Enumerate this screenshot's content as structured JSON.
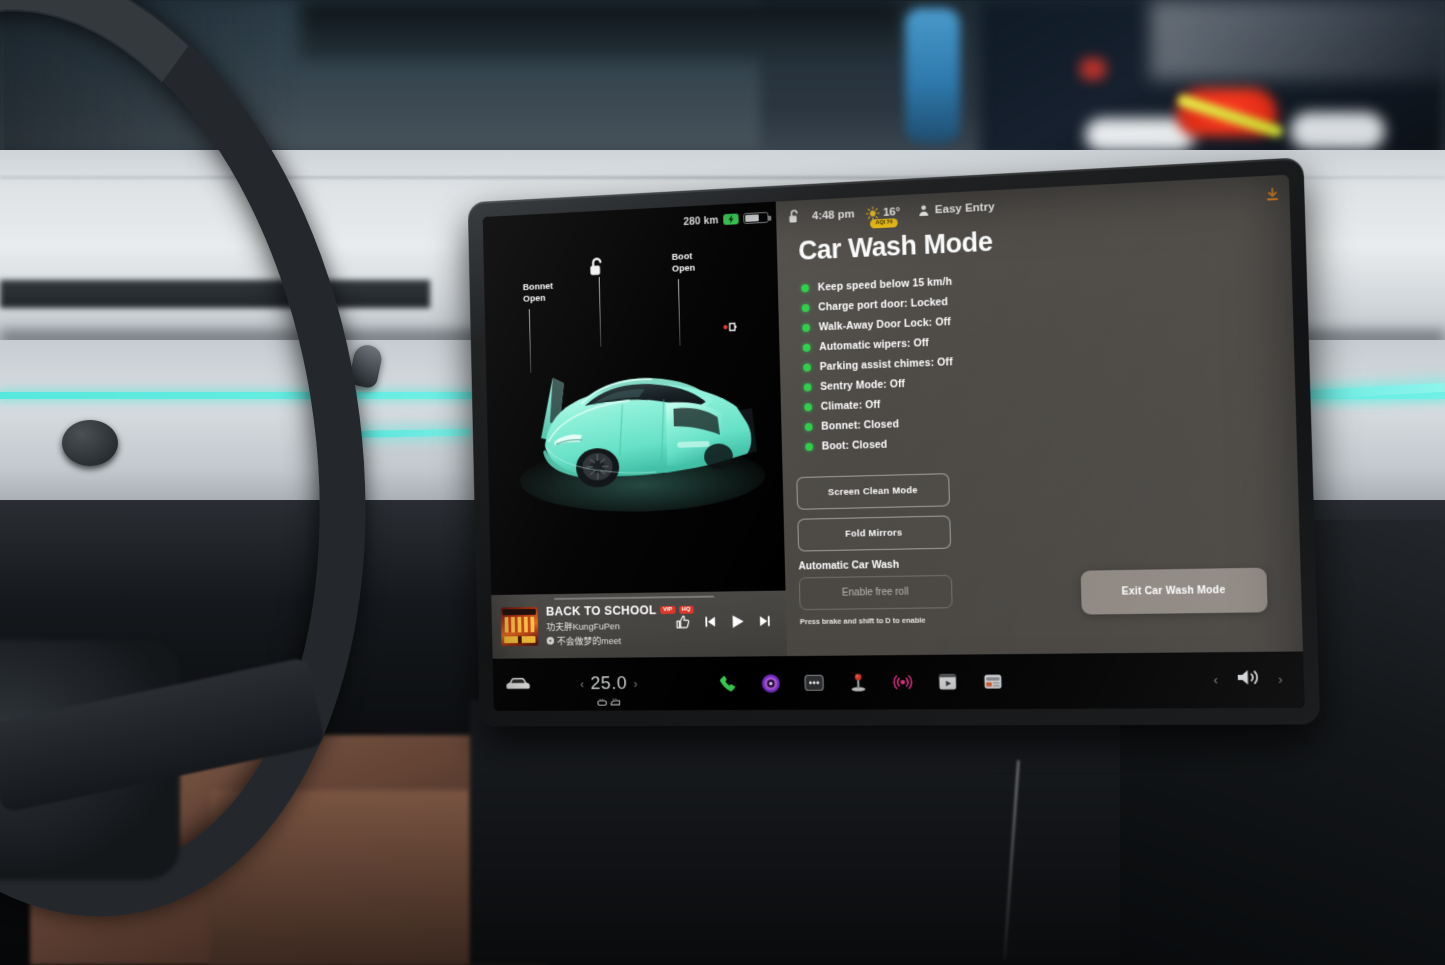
{
  "screen": {
    "left_pane": {
      "status": {
        "range": "280 km",
        "charging_icon": "charging-bolt-icon",
        "battery_icon": "battery-icon"
      },
      "car_visual": {
        "labels": [
          {
            "name": "bonnet-open-label",
            "text": "Bonnet\nOpen",
            "line1": "Bonnet",
            "line2": "Open"
          },
          {
            "name": "boot-open-label",
            "text": "Boot\nOpen",
            "line1": "Boot",
            "line2": "Open"
          }
        ],
        "icons": [
          "unlock-icon",
          "charge-port-icon"
        ],
        "car_color": "#7EE8D0",
        "model": "Model Y"
      },
      "media": {
        "title": "BACK TO SCHOOL",
        "badges": [
          "VIP",
          "HQ"
        ],
        "artist": "功夫胖KungFuPen",
        "account": "不会做梦的meet",
        "controls": [
          "thumbs-up-icon",
          "previous-track-icon",
          "play-icon",
          "next-track-icon"
        ]
      }
    },
    "right_pane": {
      "status": {
        "lock_icon": "unlock-icon",
        "time": "4:48 pm",
        "weather_icon": "sun-icon",
        "temperature": "16°",
        "aqi": "AQI 74",
        "driver_icon": "person-icon",
        "driver_profile": "Easy Entry",
        "download_icon": "download-icon",
        "accent_yellow": "#F5C518",
        "accent_orange": "#F28A1E"
      },
      "title": "Car Wash Mode",
      "status_list": [
        "Keep speed below 15 km/h",
        "Charge port door: Locked",
        "Walk-Away Door Lock: Off",
        "Automatic wipers: Off",
        "Parking assist chimes: Off",
        "Sentry Mode: Off",
        "Climate:  Off",
        "Bonnet: Closed",
        "Boot: Closed"
      ],
      "bullet_color": "#2FCF4A",
      "buttons": [
        "Screen Clean Mode",
        "Fold Mirrors"
      ],
      "section_title": "Automatic Car Wash",
      "free_roll_button": "Enable free roll",
      "hint": "Press brake and shift to D to enable",
      "exit_button": "Exit Car Wash Mode"
    },
    "bottom_bar": {
      "car_icon": "car-icon",
      "temp_prev": "‹",
      "temperature": "25.0",
      "temp_next": "›",
      "defrost_icons": [
        "rear-defrost-icon",
        "front-defrost-icon"
      ],
      "apps": [
        "phone-icon",
        "media-disc-icon",
        "more-apps-icon",
        "arcade-joystick-icon",
        "radio-icon",
        "theater-video-icon",
        "news-cards-icon"
      ],
      "volume_prev": "‹",
      "volume_icon": "volume-icon",
      "volume_next": "›"
    }
  }
}
